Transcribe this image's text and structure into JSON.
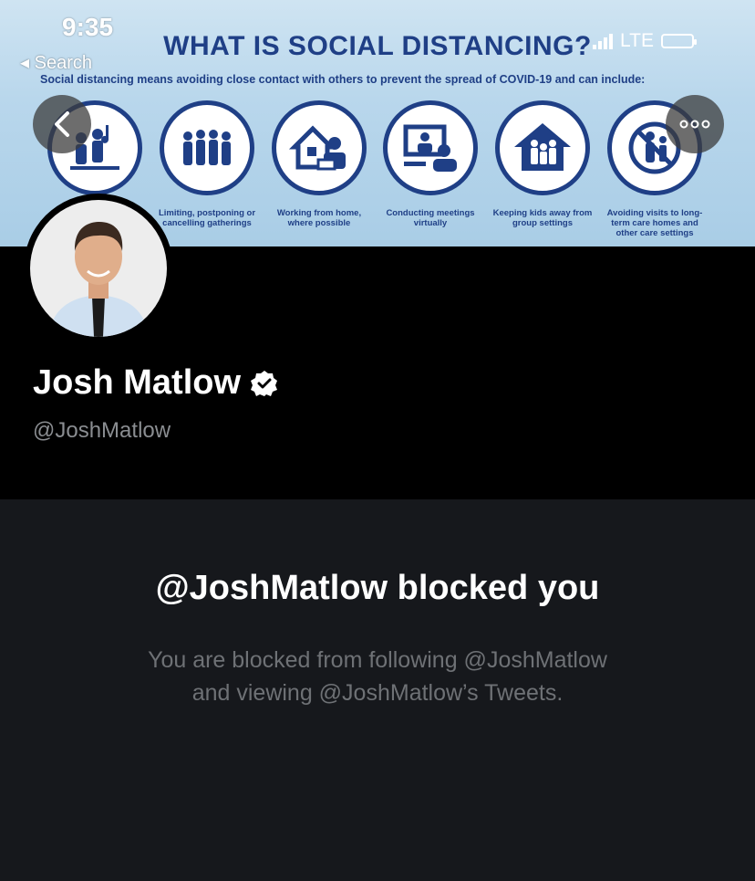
{
  "status_bar": {
    "time": "9:35",
    "back_label": "Search",
    "network": "LTE"
  },
  "banner": {
    "title": "WHAT IS SOCIAL DISTANCING?",
    "subtitle": "Social distancing means avoiding close contact with others to prevent the spread of COVID-19 and can include:",
    "items": [
      {
        "icon": "music-crowd-icon",
        "caption": ""
      },
      {
        "icon": "group-gathering-icon",
        "caption": "Limiting, postponing or cancelling gatherings"
      },
      {
        "icon": "work-from-home-icon",
        "caption": "Working from home, where possible"
      },
      {
        "icon": "virtual-meeting-icon",
        "caption": "Conducting meetings virtually"
      },
      {
        "icon": "kids-home-icon",
        "caption": "Keeping kids away from group settings"
      },
      {
        "icon": "no-visits-icon",
        "caption": "Avoiding visits to long-term care homes and other care settings"
      }
    ]
  },
  "nav": {
    "back_icon": "chevron-left-icon",
    "more_icon": "more-icon"
  },
  "profile": {
    "name": "Josh Matlow",
    "handle": "@JoshMatlow",
    "verified": true
  },
  "blocked": {
    "title": "@JoshMatlow blocked you",
    "line1": "You are blocked from following @JoshMatlow",
    "line2": "and viewing @JoshMatlow’s Tweets."
  },
  "colors": {
    "banner_blue": "#1f3f86",
    "panel_bg": "#16181c",
    "muted_text": "#6e7175",
    "handle_text": "#8a8d91"
  }
}
